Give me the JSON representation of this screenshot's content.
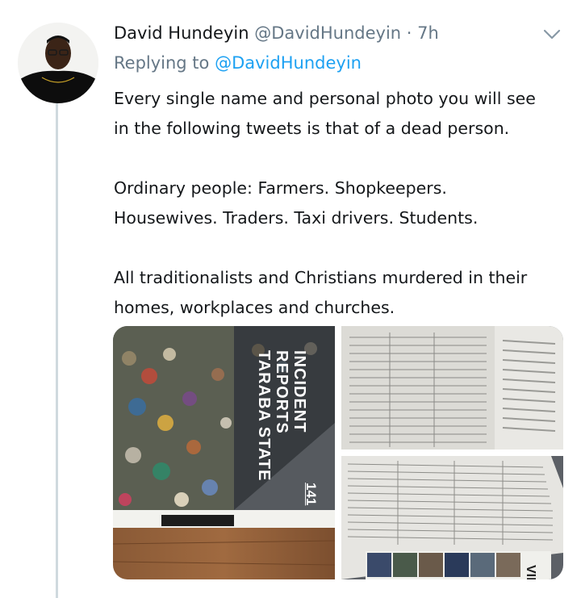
{
  "tweet": {
    "display_name": "David Hundeyin",
    "handle": "@DavidHundeyin",
    "separator": "·",
    "time": "7h",
    "replying_label": "Replying to",
    "replying_handle": "@DavidHundeyin",
    "lines": [
      "Every single name and personal photo you will see",
      "in the following tweets is that of a dead person.",
      "Ordinary people: Farmers. Shopkeepers.",
      "Housewives. Traders. Taxi drivers. Students.",
      "All traditionalists and Christians murdered in their",
      "homes, workplaces and churches."
    ],
    "menu_icon": "chevron-down-icon",
    "avatar_icon": "user-avatar"
  },
  "media": {
    "book_title_lines": [
      "INCIDENT",
      "REPORTS",
      "TARABA STATE"
    ],
    "page_number": "141",
    "page_fragment": "VIL"
  },
  "colors": {
    "secondary_text": "#657786",
    "link": "#1da1f2",
    "thread_line": "#cfd9de"
  }
}
